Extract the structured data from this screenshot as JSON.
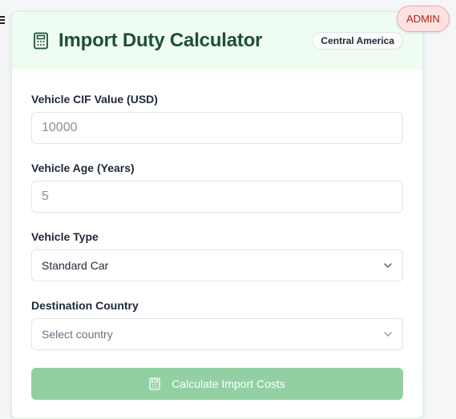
{
  "header": {
    "title": "Import Duty Calculator",
    "region_badge": "Central America"
  },
  "admin_badge": "ADMIN",
  "form": {
    "cif": {
      "label": "Vehicle CIF Value (USD)",
      "placeholder": "10000"
    },
    "age": {
      "label": "Vehicle Age (Years)",
      "placeholder": "5"
    },
    "type": {
      "label": "Vehicle Type",
      "value": "Standard Car"
    },
    "country": {
      "label": "Destination Country",
      "placeholder": "Select country"
    },
    "submit_label": "Calculate Import Costs"
  },
  "icons": {
    "menu": "menu-icon",
    "calculator": "calculator-icon",
    "chevron": "chevron-down-icon"
  },
  "colors": {
    "header_bg": "#eefcf2",
    "title": "#1f5130",
    "button": "#92d0a2",
    "admin_bg": "#fde2e2",
    "admin_text": "#b42318"
  }
}
